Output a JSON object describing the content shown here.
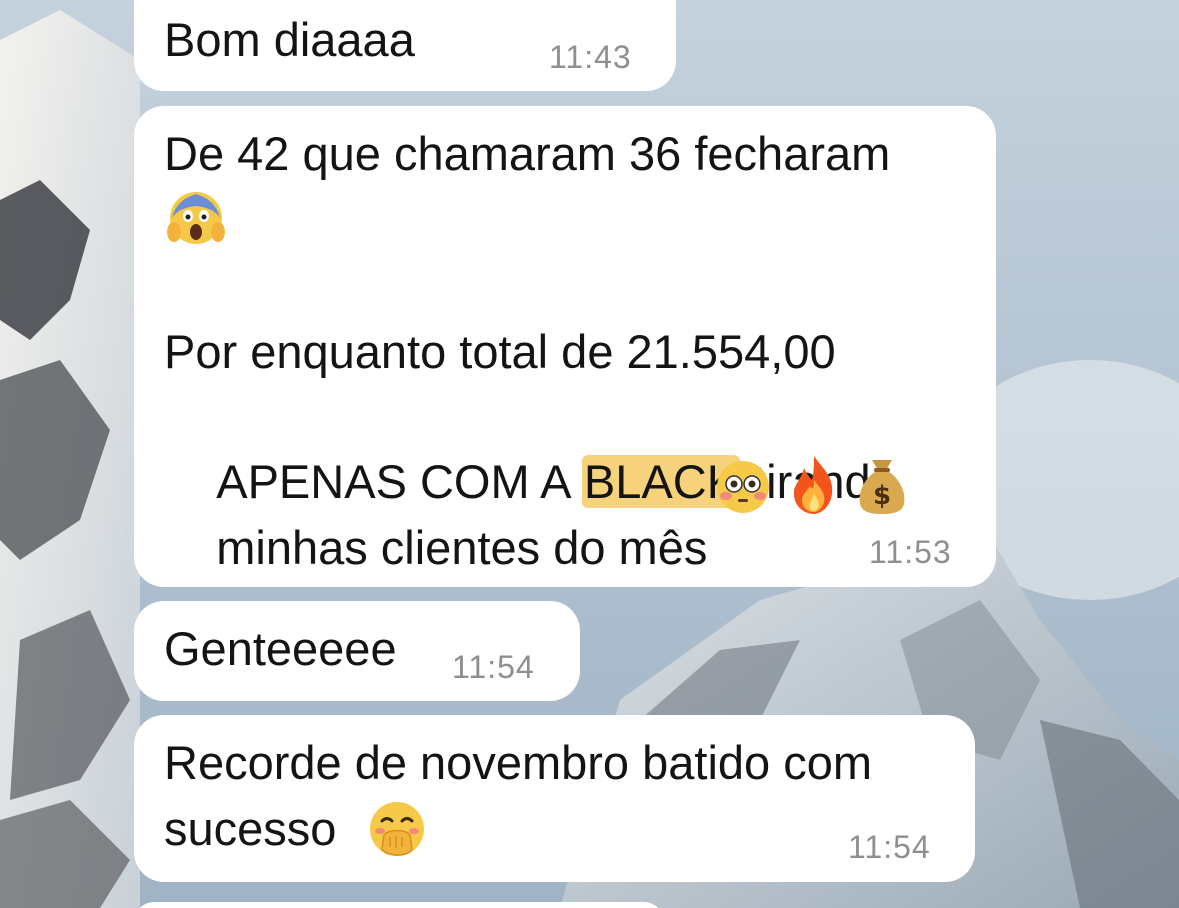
{
  "messages": [
    {
      "text": "Bom diaaaa",
      "time": "11:43"
    },
    {
      "line1": "De 42 que chamaram 36 fecharam",
      "line1_emoji": "face-screaming-in-fear",
      "line2": "Por enquanto total de 21.554,00",
      "line3_a": "APENAS COM A ",
      "line3_highlight": "BLACK",
      "line3_b": " tirando",
      "line4": "minhas clientes do mês",
      "line4_emojis": [
        "flushed-face",
        "fire",
        "money-bag"
      ],
      "time": "11:53",
      "highlight_color": "#f6d27c"
    },
    {
      "text": "Genteeeee",
      "time": "11:54"
    },
    {
      "line1": "Recorde de novembro batido com",
      "line2": "sucesso",
      "line2_emoji": "face-with-hand-over-mouth",
      "time": "11:54"
    }
  ],
  "colors": {
    "bubble": "#ffffff",
    "time": "#8e8e93",
    "text": "#141414"
  }
}
